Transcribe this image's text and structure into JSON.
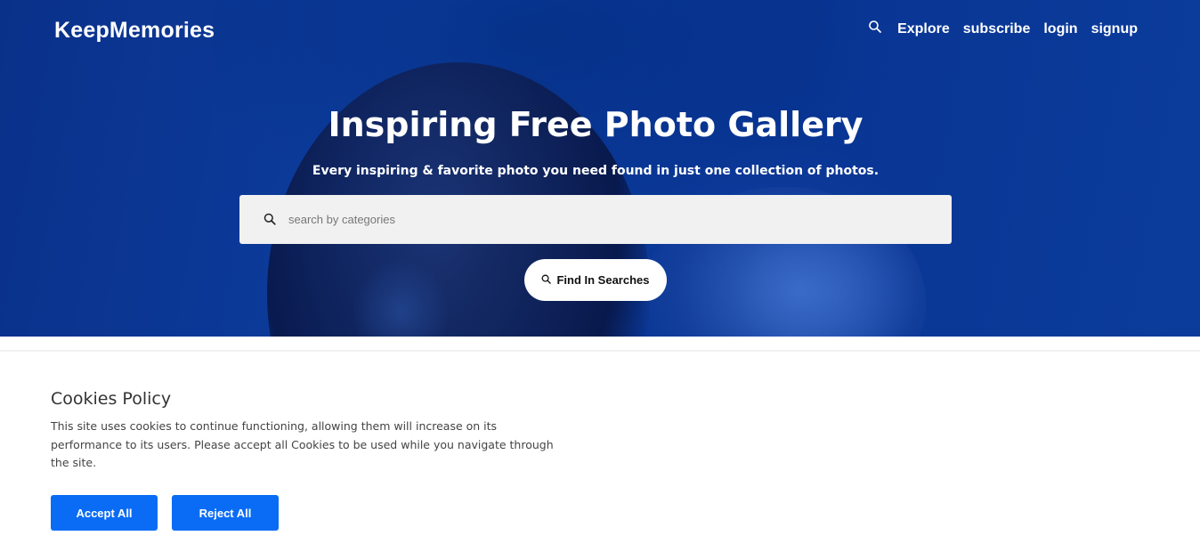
{
  "nav": {
    "brand": "KeepMemories",
    "search_icon": "search-icon",
    "links": [
      "Explore",
      "subscribe",
      "login",
      "signup"
    ]
  },
  "hero": {
    "title": "Inspiring Free Photo Gallery",
    "subtitle": "Every inspiring & favorite photo you need found in just one collection of photos.",
    "search_placeholder": "search by categories",
    "search_value": "",
    "find_button": "Find In Searches"
  },
  "cookies": {
    "title": "Cookies Policy",
    "text": "This site uses cookies to continue functioning, allowing them will increase on its performance to its users. Please accept all Cookies to be used while you navigate through the site.",
    "accept_label": "Accept All",
    "reject_label": "Reject All"
  },
  "colors": {
    "hero_blue": "#0c3d9e",
    "button_blue": "#0a6cf5",
    "search_bg": "#f1f1f1"
  }
}
